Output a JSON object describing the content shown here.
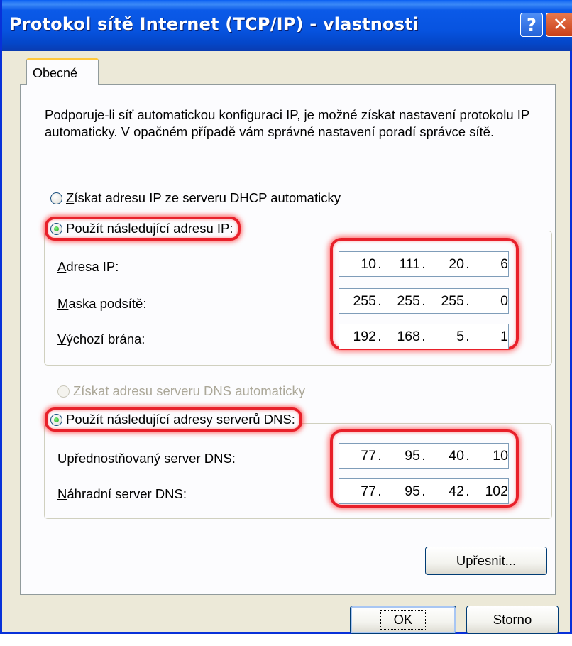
{
  "window": {
    "title": "Protokol sítě Internet (TCP/IP) - vlastnosti",
    "help_symbol": "?",
    "close_symbol": "✕"
  },
  "tabs": [
    {
      "label": "Obecné",
      "active": true
    }
  ],
  "description": "Podporuje-li síť automatickou konfiguraci IP, je možné získat nastavení protokolu IP automaticky. V opačném případě vám správné nastavení poradí správce sítě.",
  "ip_section": {
    "auto_option": {
      "mnemonic": "Z",
      "rest": "ískat adresu IP ze serveru DHCP automaticky",
      "checked": false
    },
    "manual_option": {
      "mnemonic": "P",
      "rest": "oužít následující adresu IP:",
      "checked": true
    },
    "fields": [
      {
        "mnemonic": "A",
        "rest": "dresa IP:",
        "octets": [
          "10",
          "111",
          "20",
          "6"
        ]
      },
      {
        "mnemonic": "M",
        "rest": "aska podsítě:",
        "octets": [
          "255",
          "255",
          "255",
          "0"
        ]
      },
      {
        "mnemonic": "V",
        "rest": "ýchozí brána:",
        "octets": [
          "192",
          "168",
          "5",
          "1"
        ]
      }
    ]
  },
  "dns_section": {
    "auto_option": {
      "label": "Získat adresu serveru DNS automaticky",
      "checked": false,
      "disabled": true
    },
    "manual_option": {
      "mnemonic": "P",
      "rest": "oužít následující adresy serverů DNS:",
      "checked": true
    },
    "fields": [
      {
        "pre": "Up",
        "mnemonic": "ř",
        "rest": "ednostňovaný server DNS:",
        "octets": [
          "77",
          "95",
          "40",
          "10"
        ]
      },
      {
        "pre": "",
        "mnemonic": "N",
        "rest": "áhradní server DNS:",
        "octets": [
          "77",
          "95",
          "42",
          "102"
        ]
      }
    ]
  },
  "buttons": {
    "advanced": {
      "mnemonic": "U",
      "rest": "přesnit..."
    },
    "ok": "OK",
    "cancel": "Storno"
  },
  "colors": {
    "titlebar": "#0753df",
    "dialog_bg": "#ece9d8",
    "annotation_red": "#e8202a"
  }
}
